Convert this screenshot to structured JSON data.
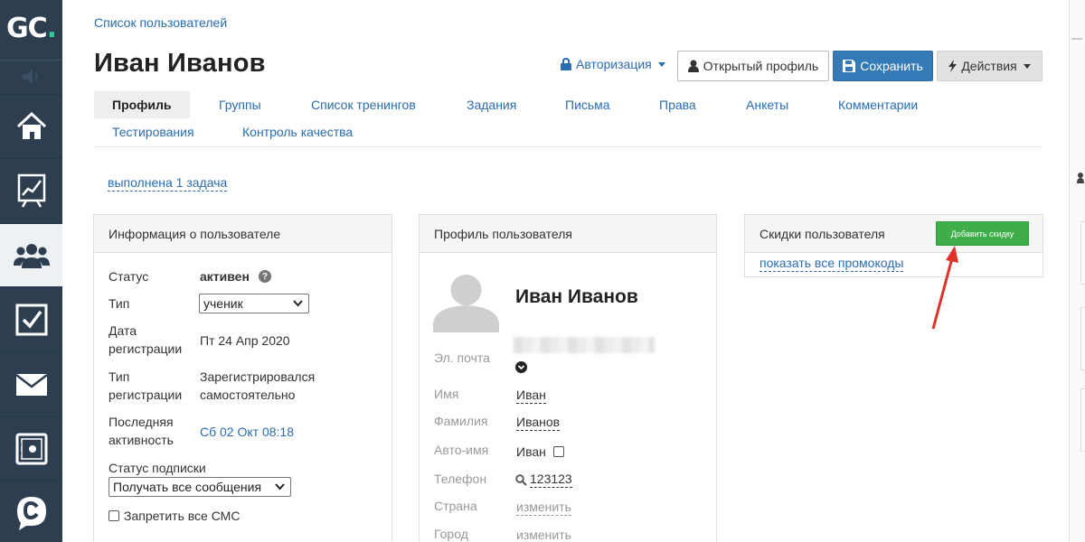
{
  "sidebar": {
    "logo": {
      "text_g": "G",
      "text_c": "C",
      "dot": "."
    },
    "items": [
      {
        "icon": "home-icon"
      },
      {
        "icon": "chart-icon"
      },
      {
        "icon": "users-icon",
        "active": true
      },
      {
        "icon": "checkbox-icon"
      },
      {
        "icon": "mail-icon"
      },
      {
        "icon": "safe-icon"
      },
      {
        "icon": "chat-icon"
      }
    ]
  },
  "breadcrumb": "Список пользователей",
  "page_title": "Иван Иванов",
  "header": {
    "auth_label": "Авторизация",
    "open_profile_label": "Открытый профиль",
    "save_label": "Сохранить",
    "actions_label": "Действия"
  },
  "tabs": [
    "Профиль",
    "Группы",
    "Список тренингов",
    "Задания",
    "Письма",
    "Права",
    "Анкеты",
    "Комментарии",
    "Тестирования",
    "Контроль качества"
  ],
  "done_link": "выполнена 1 задача",
  "user_info": {
    "title": "Информация о пользователе",
    "status_label": "Статус",
    "status_value": "активен",
    "type_label": "Тип",
    "type_value": "ученик",
    "reg_date_label_1": "Дата",
    "reg_date_label_2": "регистрации",
    "reg_date_value": "Пт 24 Апр 2020",
    "reg_type_label_1": "Тип",
    "reg_type_label_2": "регистрации",
    "reg_type_value_1": "Зарегистрировался",
    "reg_type_value_2": "самостоятельно",
    "last_activity_label_1": "Последняя",
    "last_activity_label_2": "активность",
    "last_activity_value": "Сб 02 Окт 08:18",
    "subscription_label": "Статус подписки",
    "subscription_value": "Получать все сообщения",
    "no_sms_label": "Запретить все СМС"
  },
  "profile": {
    "title": "Профиль пользователя",
    "name": "Иван Иванов",
    "email_label": "Эл. почта",
    "first_name_label": "Имя",
    "first_name_value": "Иван",
    "last_name_label": "Фамилия",
    "last_name_value": "Иванов",
    "auto_name_label": "Авто-имя",
    "auto_name_value": "Иван",
    "phone_label": "Телефон",
    "phone_value": "123123",
    "country_label": "Страна",
    "country_value": "изменить",
    "city_label": "Город",
    "city_value": "изменить"
  },
  "discounts": {
    "title": "Скидки пользователя",
    "add_button": "Добавить скидку",
    "show_promos": "показать все промокоды"
  },
  "colors": {
    "sidebar_bg": "#2c3e50",
    "link": "#2a6cb0",
    "save_btn": "#337ab7",
    "add_btn": "#3fae49",
    "arrow": "#e0322b"
  }
}
